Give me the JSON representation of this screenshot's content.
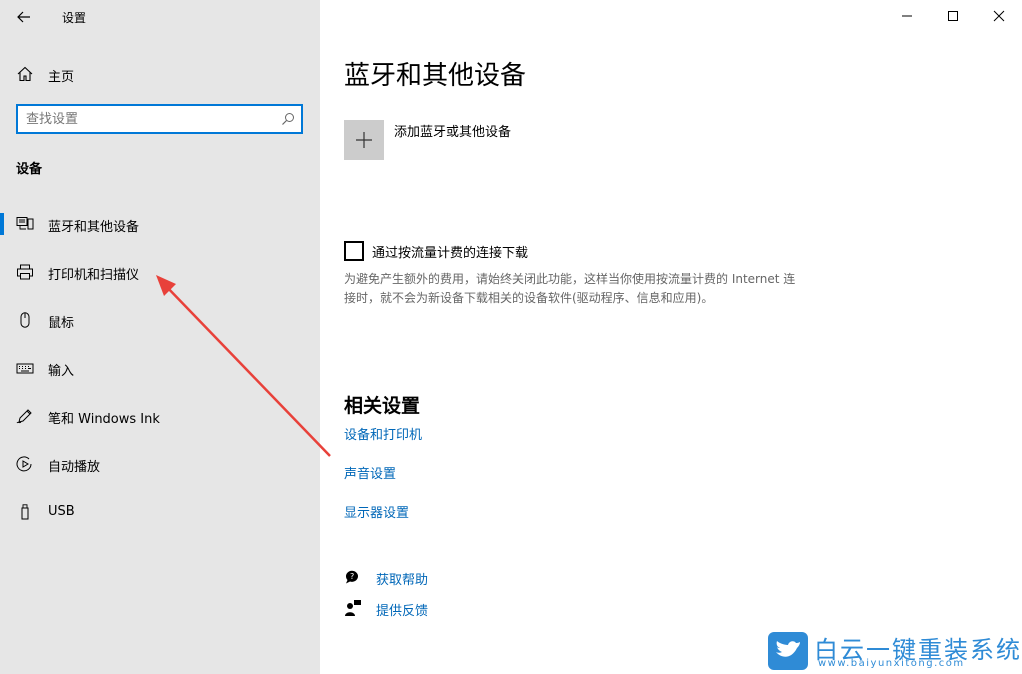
{
  "window": {
    "title": "设置",
    "controls": [
      "minimize-icon",
      "maximize-icon",
      "close-icon"
    ]
  },
  "sidebar": {
    "home_label": "主页",
    "search_placeholder": "查找设置",
    "section_label": "设备",
    "items": [
      {
        "label": "蓝牙和其他设备",
        "icon": "bluetooth-devices-icon",
        "selected": true
      },
      {
        "label": "打印机和扫描仪",
        "icon": "printer-icon",
        "selected": false
      },
      {
        "label": "鼠标",
        "icon": "mouse-icon",
        "selected": false
      },
      {
        "label": "输入",
        "icon": "keyboard-icon",
        "selected": false
      },
      {
        "label": "笔和 Windows Ink",
        "icon": "pen-icon",
        "selected": false
      },
      {
        "label": "自动播放",
        "icon": "autoplay-icon",
        "selected": false
      },
      {
        "label": "USB",
        "icon": "usb-icon",
        "selected": false
      }
    ]
  },
  "main": {
    "title": "蓝牙和其他设备",
    "add_device_label": "添加蓝牙或其他设备",
    "metered": {
      "label": "通过按流量计费的连接下载",
      "checked": false,
      "description": "为避免产生额外的费用，请始终关闭此功能，这样当你使用按流量计费的 Internet 连接时，就不会为新设备下载相关的设备软件(驱动程序、信息和应用)。"
    },
    "related_heading": "相关设置",
    "related_links": [
      "设备和打印机",
      "声音设置",
      "显示器设置"
    ],
    "help": {
      "get_help": "获取帮助",
      "feedback": "提供反馈"
    }
  },
  "watermark": {
    "cn": "白云一键重装系统",
    "en": "www.baiyunxitong.com"
  },
  "colors": {
    "accent": "#0078d7",
    "link": "#0067b8",
    "sidebar_bg": "#e6e6e6",
    "arrow": "#e8413a",
    "watermark": "#2f8bd6"
  }
}
